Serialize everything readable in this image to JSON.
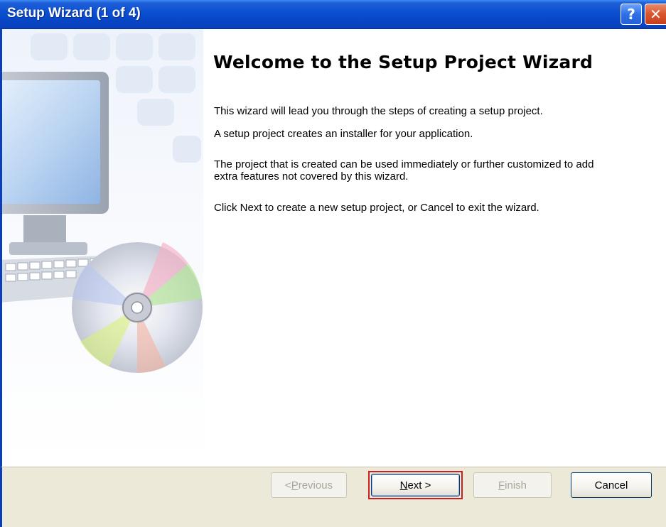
{
  "window": {
    "title": "Setup Wizard (1 of 4)",
    "help_glyph": "?",
    "close_glyph": "✕"
  },
  "main": {
    "heading": "Welcome to the Setup Project Wizard",
    "paragraphs": [
      "This wizard will lead you through the steps of creating a setup project.",
      "A setup project creates an installer for your application.",
      "The project that is created can be used immediately or further customized to add extra features not covered by this wizard.",
      "Click Next to create a new setup project, or Cancel to exit the wizard."
    ]
  },
  "buttons": {
    "previous": {
      "prefix": "< ",
      "mnemonic": "P",
      "rest": "revious",
      "enabled": false
    },
    "next": {
      "mnemonic": "N",
      "rest": "ext >",
      "enabled": true,
      "highlighted_color": "#cc1f1f"
    },
    "finish": {
      "mnemonic": "F",
      "rest": "inish",
      "enabled": false
    },
    "cancel": {
      "label": "Cancel",
      "enabled": true
    }
  },
  "icons": {
    "left_art": [
      "computer-monitor-icon",
      "keyboard-icon",
      "cd-disc-icon"
    ]
  },
  "colors": {
    "titlebar": "#0a4fd0",
    "button_bar": "#ece9d8",
    "highlight": "#cc1f1f"
  }
}
